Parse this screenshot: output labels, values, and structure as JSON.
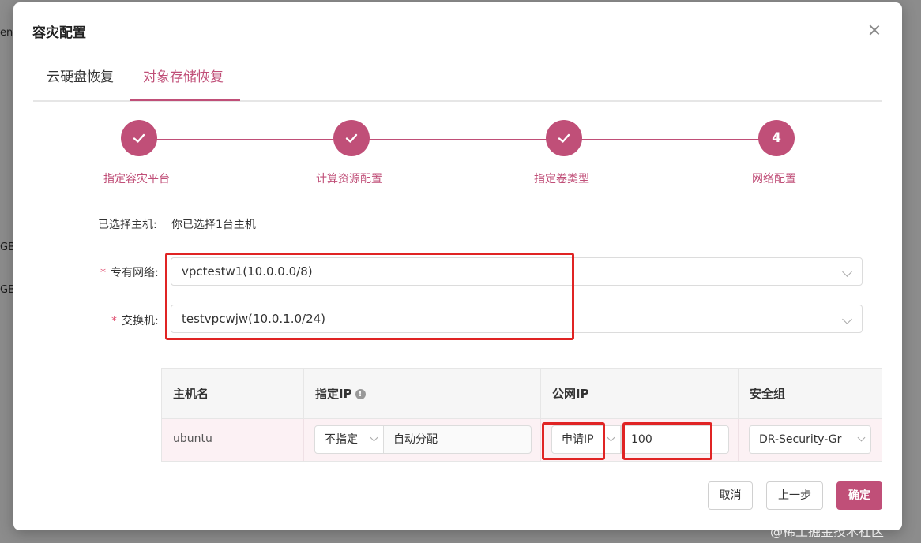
{
  "background": {
    "fragments": [
      "en",
      "GB",
      "GB"
    ]
  },
  "modal": {
    "title": "容灾配置",
    "tabs": [
      {
        "label": "云硬盘恢复",
        "active": false
      },
      {
        "label": "对象存储恢复",
        "active": true
      }
    ],
    "steps": [
      {
        "label": "指定容灾平台",
        "status": "done"
      },
      {
        "label": "计算资源配置",
        "status": "done"
      },
      {
        "label": "指定卷类型",
        "status": "done"
      },
      {
        "label": "网络配置",
        "status": "current",
        "number": "4"
      }
    ],
    "form": {
      "selected_hosts_label": "已选择主机:",
      "selected_hosts_value": "你已选择1台主机",
      "vpc_label": "专有网络:",
      "vpc_value": "vpctestw1(10.0.0.0/8)",
      "switch_label": "交换机:",
      "switch_value": "testvpcwjw(10.0.1.0/24)",
      "required_mark": "*"
    },
    "table": {
      "headers": [
        "主机名",
        "指定IP",
        "公网IP",
        "安全组"
      ],
      "info_icon_text": "!",
      "rows": [
        {
          "hostname": "ubuntu",
          "ip_mode": "不指定",
          "ip_value": "自动分配",
          "public_ip_mode": "申请IP",
          "public_ip_bandwidth": "100",
          "security_group": "DR-Security-Gr"
        }
      ]
    },
    "buttons": {
      "cancel": "取消",
      "prev": "上一步",
      "confirm": "确定"
    }
  },
  "watermark": "@稀土掘金技术社区",
  "colors": {
    "accent": "#c04f78",
    "highlight": "#e02424"
  }
}
